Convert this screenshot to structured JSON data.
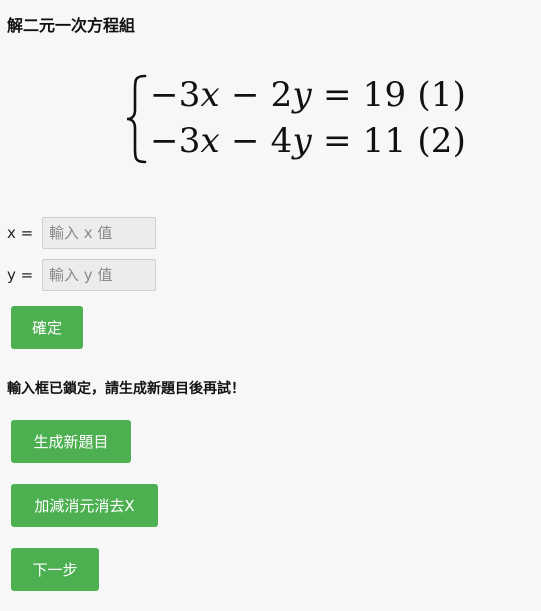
{
  "title": "解二元一次方程組",
  "equations": {
    "line1": {
      "sign_a": "−",
      "coef_a": "3",
      "var_a": "x",
      "op": "−",
      "coef_b": "2",
      "var_b": "y",
      "eq": "=",
      "rhs": "19",
      "tag": "(1)"
    },
    "line2": {
      "sign_a": "−",
      "coef_a": "3",
      "var_a": "x",
      "op": "−",
      "coef_b": "4",
      "var_b": "y",
      "eq": "=",
      "rhs": "11",
      "tag": "(2)"
    }
  },
  "inputs": {
    "x": {
      "label": "x =",
      "placeholder": "輸入 x 值",
      "value": ""
    },
    "y": {
      "label": "y =",
      "placeholder": "輸入 y 值",
      "value": ""
    }
  },
  "buttons": {
    "confirm": "確定",
    "new_problem": "生成新題目",
    "elimination": "加減消元消去X",
    "next_step": "下一步"
  },
  "status_message": "輸入框已鎖定，請生成新題目後再試！",
  "colors": {
    "button_bg": "#4caf50",
    "button_text": "#ffffff",
    "page_bg": "#f7f7f7"
  }
}
